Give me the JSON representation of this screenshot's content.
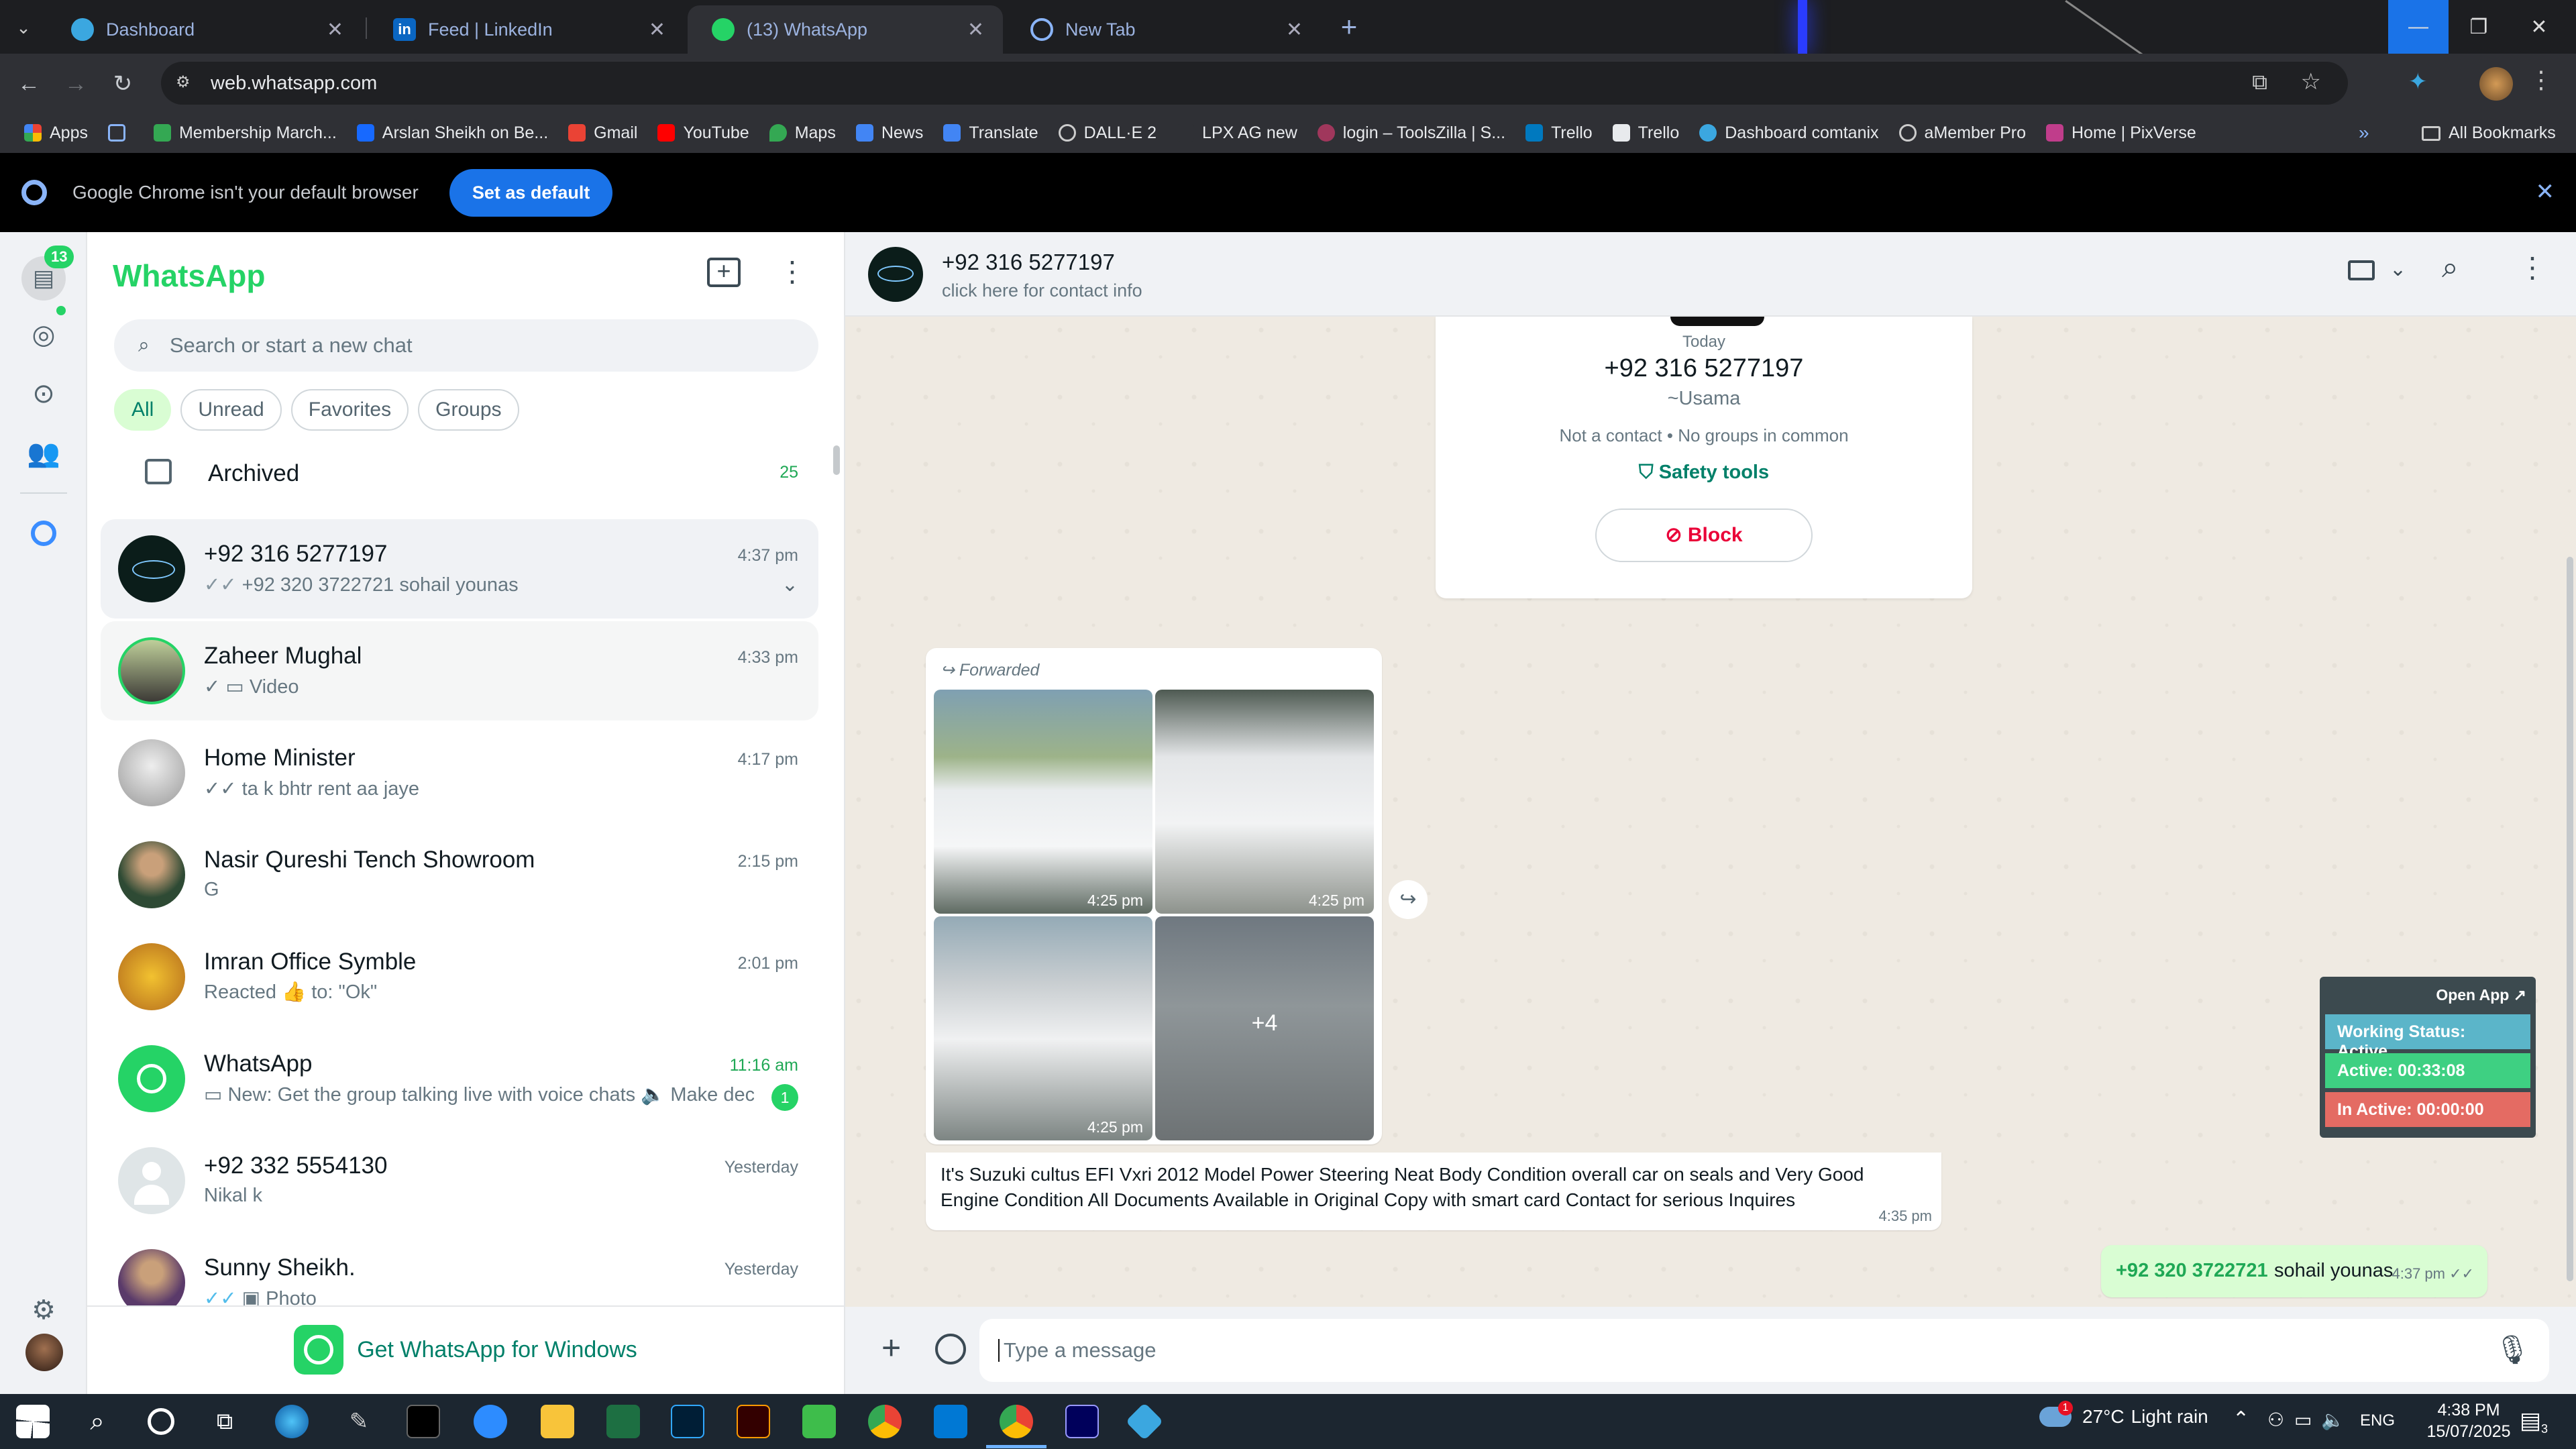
{
  "browser": {
    "tabs": [
      {
        "title": "Dashboard",
        "color": "#3ba7e0"
      },
      {
        "title": "Feed | LinkedIn",
        "color": "#0a66c2"
      },
      {
        "title": "(13) WhatsApp",
        "color": "#25d366"
      },
      {
        "title": "New Tab",
        "color": "#8ab4f8"
      }
    ],
    "url": "web.whatsapp.com",
    "bookmarks": [
      "Apps",
      "Membership March...",
      "Arslan Sheikh on Be...",
      "Gmail",
      "YouTube",
      "Maps",
      "News",
      "Translate",
      "DALL·E 2",
      "LPX AG new",
      "login – ToolsZilla | S...",
      "Trello",
      "Trello",
      "Dashboard comtanix",
      "aMember Pro",
      "Home | PixVerse"
    ],
    "all_bookmarks": "All Bookmarks",
    "infobar_text": "Google Chrome isn't your default browser",
    "set_default": "Set as default"
  },
  "rail": {
    "chats_badge": "13"
  },
  "sidebar": {
    "title": "WhatsApp",
    "search_placeholder": "Search or start a new chat",
    "filters": [
      "All",
      "Unread",
      "Favorites",
      "Groups"
    ],
    "archived_label": "Archived",
    "archived_count": "25",
    "chats": [
      {
        "name": "+92 316 5277197",
        "preview": "+92 320 3722721  sohail younas",
        "time": "4:37 pm",
        "ticks": "✓✓"
      },
      {
        "name": "Zaheer Mughal",
        "preview": "Video",
        "time": "4:33 pm",
        "ticks": "✓"
      },
      {
        "name": "Home Minister",
        "preview": "ta k bhtr rent aa jaye",
        "time": "4:17 pm",
        "ticks": "✓✓"
      },
      {
        "name": "Nasir Qureshi Tench Showroom",
        "preview": "G",
        "time": "2:15 pm",
        "ticks": ""
      },
      {
        "name": "Imran Office Symble",
        "preview": "Reacted 👍 to: \"Ok\"",
        "time": "2:01 pm",
        "ticks": ""
      },
      {
        "name": "WhatsApp",
        "preview": "New: Get the group talking live with voice chats 🔈 Make dec...",
        "time": "11:16 am",
        "ticks": "",
        "unread": "1"
      },
      {
        "name": "+92 332 5554130",
        "preview": "Nikal k",
        "time": "Yesterday",
        "ticks": ""
      },
      {
        "name": "Sunny Sheikh.",
        "preview": "Photo",
        "time": "Yesterday",
        "ticks": "✓✓"
      }
    ],
    "get_windows": "Get WhatsApp for Windows"
  },
  "chat": {
    "contact_name": "+92 316 5277197",
    "contact_sub": "click here for contact info",
    "day_label": "Today",
    "info_number": "+92 316 5277197",
    "info_alias": "~Usama",
    "info_note": "Not a contact • No groups in common",
    "safety_tools": "Safety tools",
    "block": "Block",
    "forwarded": "Forwarded",
    "img_times": [
      "4:25 pm",
      "4:25 pm",
      "4:25 pm"
    ],
    "more_images": "+4",
    "message_text": "It's Suzuki cultus EFI Vxri 2012 Model Power Steering Neat Body Condition overall car on seals and Very Good Engine Condition All Documents Available in Original Copy with smart card Contact for serious Inquires",
    "message_time": "4:35 pm",
    "out_contact_number": "+92 320 3722721",
    "out_contact_name": "sohail younas",
    "out_time": "4:37 pm",
    "composer_placeholder": "Type a message"
  },
  "widget": {
    "open_app": "Open App ↗",
    "status": "Working Status: Active",
    "active": "Active: 00:33:08",
    "inactive": "In Active: 00:00:00"
  },
  "taskbar": {
    "weather_temp": "27°C",
    "weather_desc": "Light rain",
    "weather_badge": "1",
    "lang": "ENG",
    "time": "4:38 PM",
    "date": "15/07/2025",
    "notif_count": "3"
  }
}
